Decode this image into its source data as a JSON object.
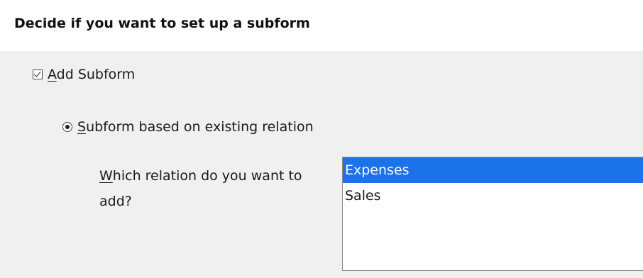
{
  "header": {
    "title": "Decide if you want to set up a subform"
  },
  "add_subform": {
    "checked": true,
    "label_mnemonic": "A",
    "label_rest": "dd Subform"
  },
  "relation_option": {
    "selected": true,
    "label_mnemonic": "S",
    "label_rest": "ubform based on existing relation"
  },
  "relation_question": {
    "label_mnemonic": "W",
    "label_rest": "hich relation do you want to add?"
  },
  "relations_list": {
    "items": [
      {
        "label": "Expenses",
        "selected": true
      },
      {
        "label": "Sales",
        "selected": false
      }
    ]
  },
  "colors": {
    "selection": "#1a73e8",
    "header_bg": "#ffffff",
    "panel_bg": "#f0f0f0"
  }
}
